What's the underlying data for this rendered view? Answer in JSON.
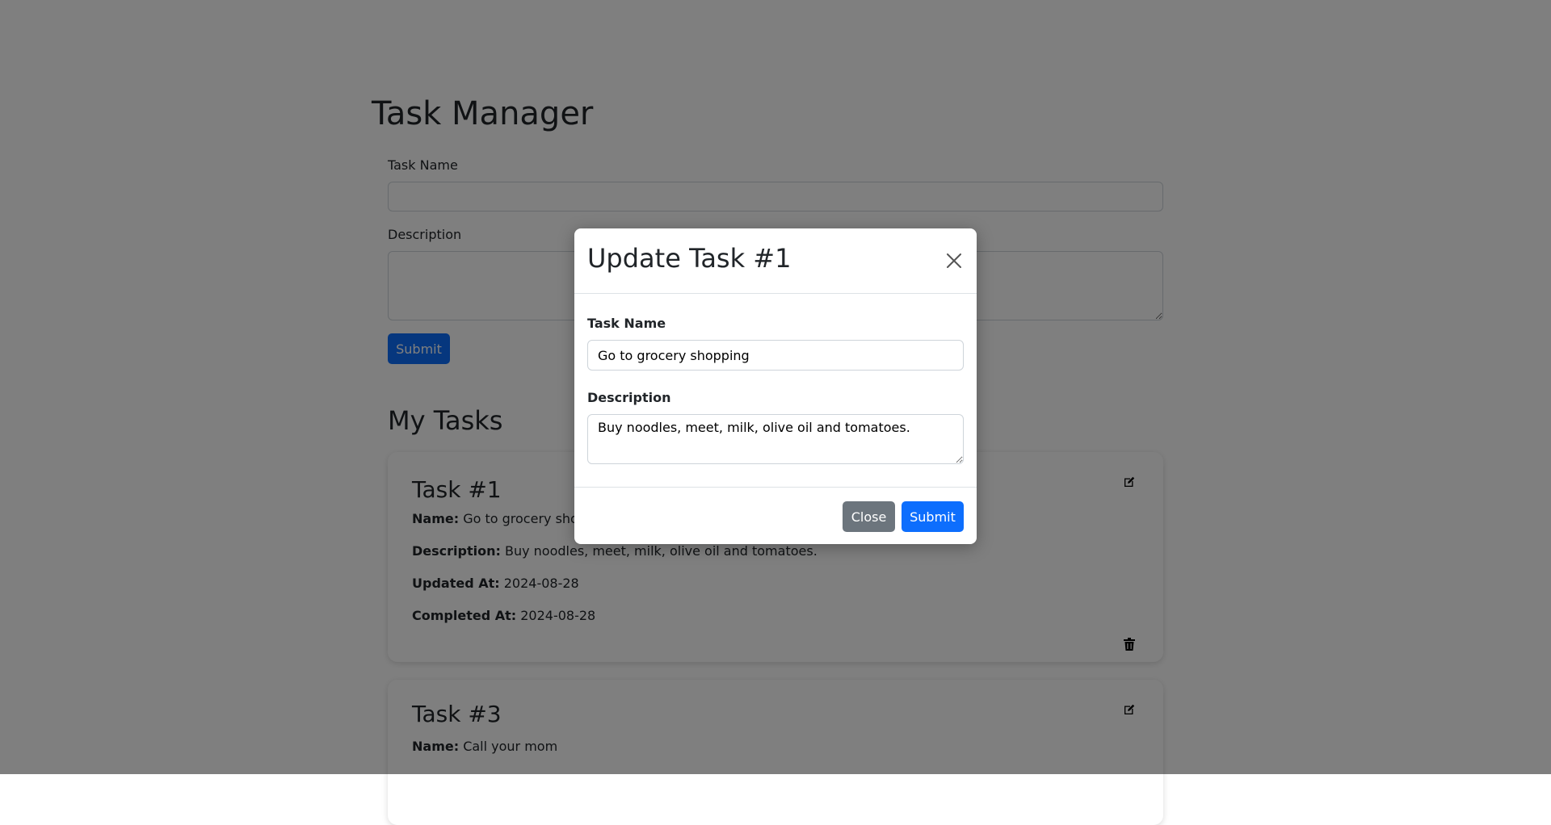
{
  "app": {
    "title": "Task Manager"
  },
  "create_form": {
    "task_name_label": "Task Name",
    "task_name_value": "",
    "description_label": "Description",
    "description_value": "",
    "submit_label": "Submit"
  },
  "tasks_section": {
    "title": "My Tasks"
  },
  "tasks": [
    {
      "title": "Task #1",
      "name_label": "Name:",
      "name": "Go to grocery shopping",
      "description_label": "Description:",
      "description": "Buy noodles, meet, milk, olive oil and tomatoes.",
      "updated_label": "Updated At:",
      "updated_at": "2024-08-28",
      "completed_label": "Completed At:",
      "completed_at": "2024-08-28"
    },
    {
      "title": "Task #3",
      "name_label": "Name:",
      "name": "Call your mom"
    }
  ],
  "modal": {
    "title": "Update Task #1",
    "task_name_label": "Task Name",
    "task_name_value": "Go to grocery shopping",
    "description_label": "Description",
    "description_value": "Buy noodles, meet, milk, olive oil and tomatoes.",
    "close_label": "Close",
    "submit_label": "Submit"
  },
  "icons": {
    "edit": "edit-icon",
    "delete": "trash-icon",
    "close": "close-icon"
  },
  "colors": {
    "primary": "#0d6efd",
    "secondary": "#6c757d",
    "backdrop": "rgba(0,0,0,0.5)"
  }
}
